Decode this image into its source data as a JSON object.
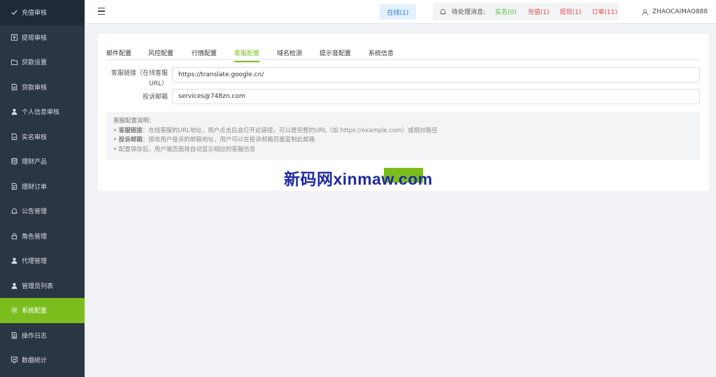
{
  "sidebar": {
    "items": [
      {
        "label": "充值审核",
        "icon": "check-icon"
      },
      {
        "label": "提现审核",
        "icon": "withdraw-icon"
      },
      {
        "label": "贷款设置",
        "icon": "folder-icon"
      },
      {
        "label": "贷款审核",
        "icon": "document-icon"
      },
      {
        "label": "个人信息审核",
        "icon": "user-icon"
      },
      {
        "label": "实名审核",
        "icon": "id-card-icon"
      },
      {
        "label": "理财产品",
        "icon": "database-icon"
      },
      {
        "label": "理财订单",
        "icon": "order-icon"
      },
      {
        "label": "公告管理",
        "icon": "bell-icon"
      },
      {
        "label": "角色管理",
        "icon": "lock-icon"
      },
      {
        "label": "代理管理",
        "icon": "agent-icon"
      },
      {
        "label": "管理员列表",
        "icon": "admin-icon"
      },
      {
        "label": "系统配置",
        "icon": "gear-icon"
      },
      {
        "label": "操作日志",
        "icon": "log-icon"
      },
      {
        "label": "数据统计",
        "icon": "stats-icon"
      }
    ]
  },
  "header": {
    "online_label": "在线(1)",
    "pending_label": "待处理消息:",
    "pending_items": [
      {
        "label": "实名(0)"
      },
      {
        "label": "充值(1)"
      },
      {
        "label": "提现(1)"
      },
      {
        "label": "订单(11)"
      }
    ],
    "username": "ZHAOCAIMAO888"
  },
  "tabs": [
    {
      "label": "邮件配置"
    },
    {
      "label": "风控配置"
    },
    {
      "label": "行情配置"
    },
    {
      "label": "客服配置"
    },
    {
      "label": "域名检测"
    },
    {
      "label": "提示音配置"
    },
    {
      "label": "系统信息"
    }
  ],
  "form": {
    "service_link_label_line1": "客服链接（在线客服",
    "service_link_label_line2": "URL）",
    "service_link_value": "https://translate.google.cn/",
    "complaint_email_label": "投诉邮箱",
    "complaint_email_value": "services@748zn.com"
  },
  "notes": {
    "title": "客服配置说明：",
    "line1_bold": "客服链接",
    "line1_text": "：在线客服的URL地址，用户点击后会打开此链接。可以是完整的URL（如 https://example.com）或相对路径",
    "line2_bold": "投诉邮箱",
    "line2_text": "：接收用户投诉的邮箱地址，用户可以在投诉邮箱页面复制此邮箱",
    "line3_text": "配置保存后，用户端页面将自动显示相应的客服信息"
  },
  "watermark": "新码网xinmaw.com",
  "colors": {
    "sidebar_bg": "#2b3644",
    "accent": "#7cbd1e",
    "online_text": "#2d7fd0",
    "pending_green": "#52b83a",
    "pending_red": "#e94a4a"
  }
}
